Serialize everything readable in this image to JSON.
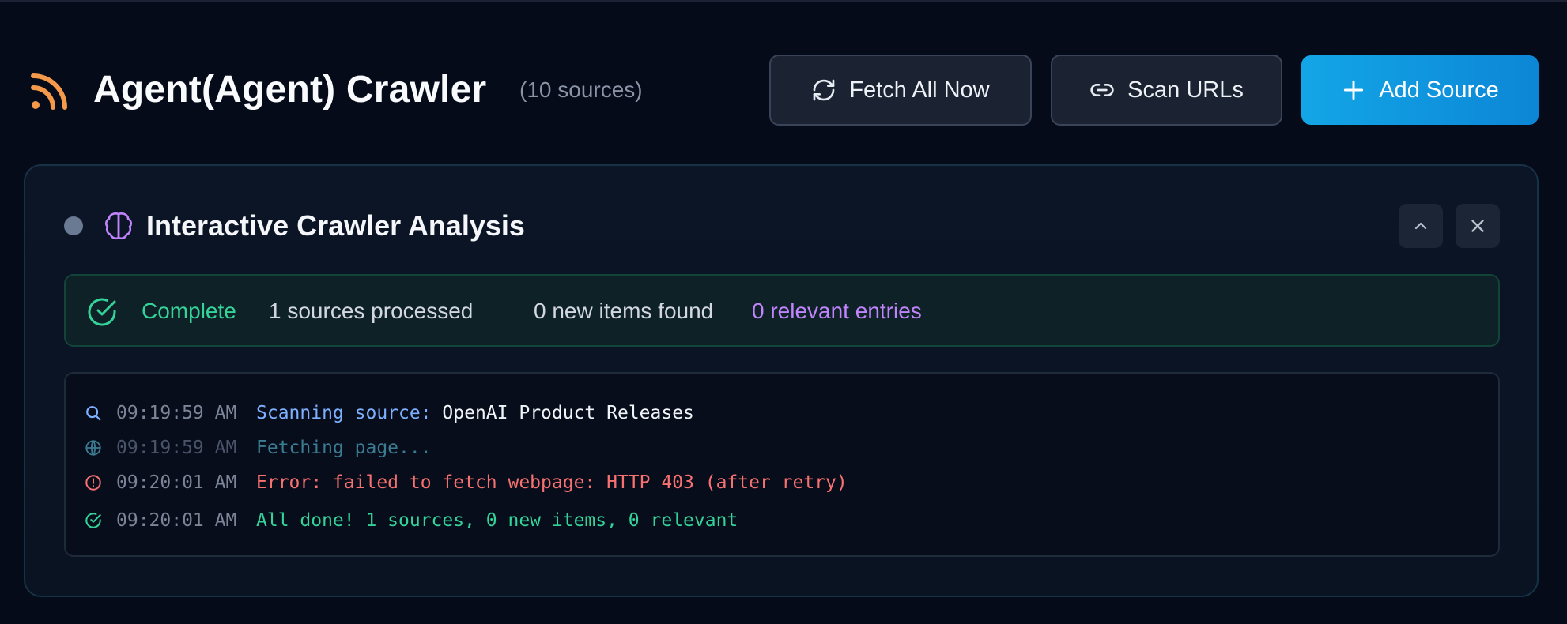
{
  "header": {
    "title": "Agent(Agent) Crawler",
    "source_count": "(10 sources)",
    "buttons": {
      "fetch_all": "Fetch All Now",
      "scan_urls": "Scan URLs",
      "add_source": "Add Source"
    }
  },
  "panel": {
    "title": "Interactive Crawler Analysis",
    "summary": {
      "status": "Complete",
      "processed": "1 sources processed",
      "new_items": "0 new items found",
      "relevant": "0 relevant entries"
    },
    "log": [
      {
        "icon": "search-icon",
        "time": "09:19:59 AM",
        "message": "Scanning source:",
        "detail": "OpenAI Product Releases",
        "color": "#7db0ff"
      },
      {
        "icon": "globe-icon",
        "time": "09:19:59 AM",
        "message": "Fetching page...",
        "detail": "",
        "color": "#3b7c93"
      },
      {
        "icon": "alert-circle-icon",
        "time": "09:20:01 AM",
        "message": "Error: failed to fetch webpage: HTTP 403 (after retry)",
        "detail": "",
        "color": "#f87171"
      },
      {
        "icon": "check-circle-icon",
        "time": "09:20:01 AM",
        "message": "All done! 1 sources, 0 new items, 0 relevant",
        "detail": "",
        "color": "#34d399"
      }
    ]
  },
  "colors": {
    "background": "#060b19",
    "accent": "#13a6e6",
    "rss": "#f59a4a",
    "success": "#34d399",
    "error": "#f87171",
    "purple": "#c084fc"
  }
}
